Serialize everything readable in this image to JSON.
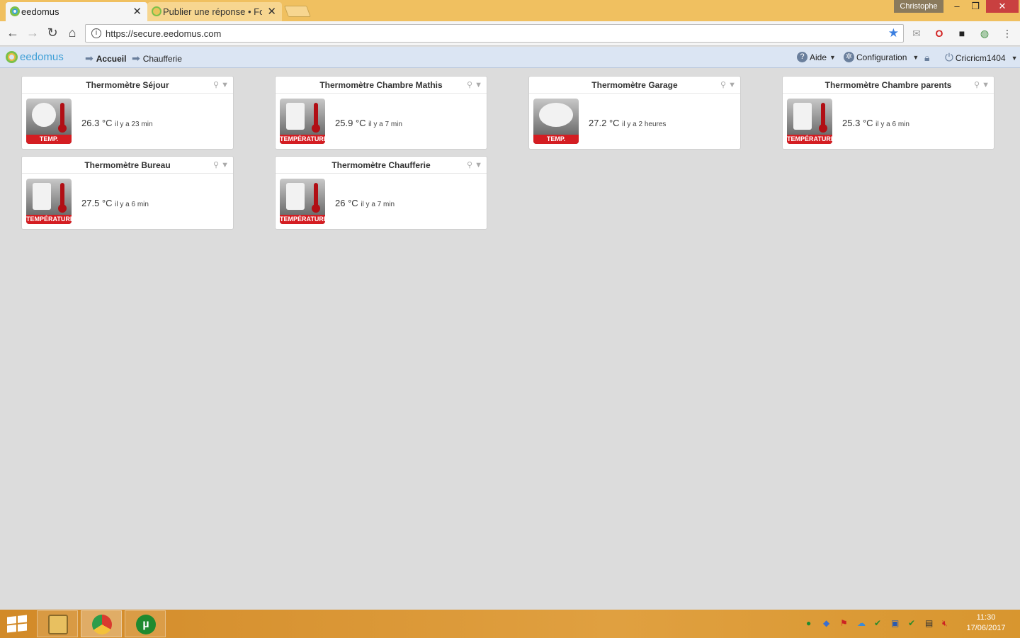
{
  "browser": {
    "tabs": [
      {
        "label": "eedomus",
        "close": "✕"
      },
      {
        "label": "Publier une réponse • Fo",
        "close": "✕"
      }
    ],
    "user": "Christophe",
    "window_controls": {
      "minimize": "–",
      "restore": "❐",
      "close": "✕"
    },
    "url": "https://secure.eedomus.com"
  },
  "app": {
    "logo": "eedomus",
    "breadcrumbs": [
      "Accueil",
      "Chaufferie"
    ],
    "menu": {
      "help": "Aide",
      "config": "Configuration",
      "user": "Cricricm1404"
    }
  },
  "widgets": [
    {
      "title": "Thermomètre Séjour",
      "value": "26.3",
      "unit": "°C",
      "ago": "il y a 23 min",
      "badge": "TEMP."
    },
    {
      "title": "Thermomètre Chambre Mathis",
      "value": "25.9",
      "unit": "°C",
      "ago": "il y a 7 min",
      "badge": "TEMPÉRATURE"
    },
    {
      "title": "Thermomètre Garage",
      "value": "27.2",
      "unit": "°C",
      "ago": "il y a 2 heures",
      "badge": "TEMP."
    },
    {
      "title": "Thermomètre Chambre parents",
      "value": "25.3",
      "unit": "°C",
      "ago": "il y a 6 min",
      "badge": "TEMPÉRATURE"
    },
    {
      "title": "Thermomètre Bureau",
      "value": "27.5",
      "unit": "°C",
      "ago": "il y a 6 min",
      "badge": "TEMPÉRATURE"
    },
    {
      "title": "Thermomètre Chaufferie",
      "value": "26",
      "unit": "°C",
      "ago": "il y a 7 min",
      "badge": "TEMPÉRATURE"
    }
  ],
  "taskbar": {
    "time": "11:30",
    "date": "17/06/2017"
  }
}
